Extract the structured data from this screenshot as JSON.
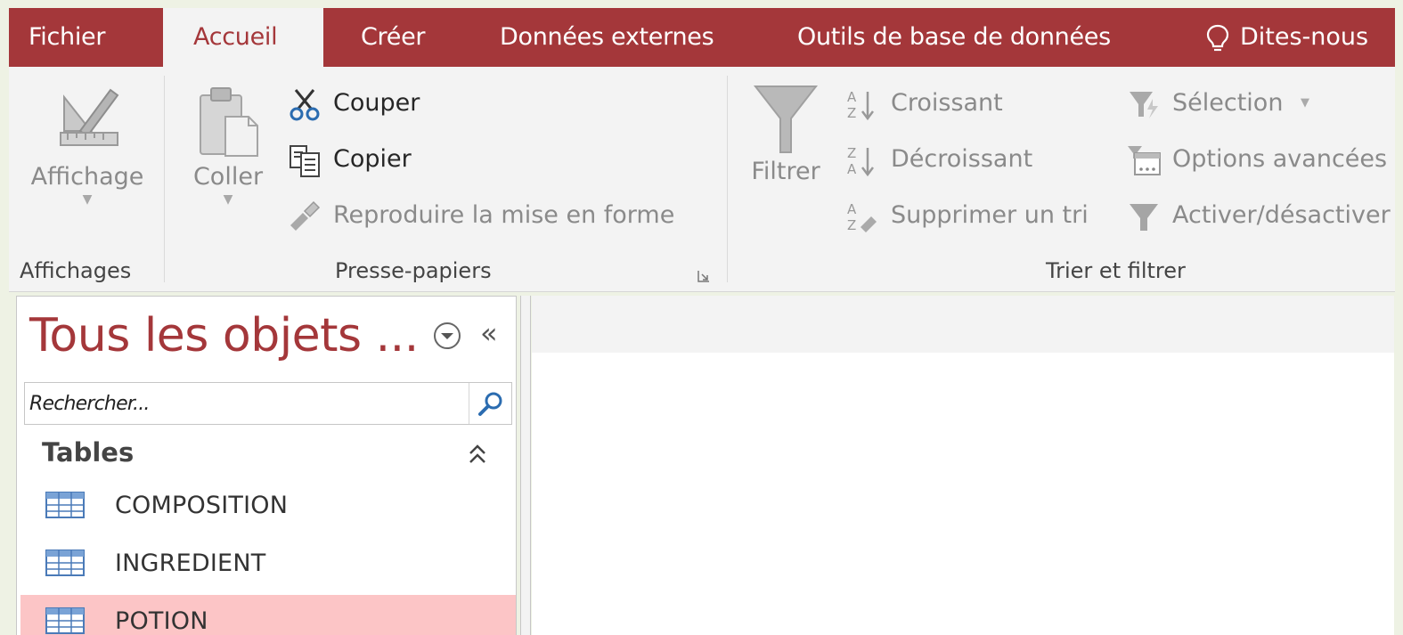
{
  "tabs": {
    "fichier": "Fichier",
    "accueil": "Accueil",
    "creer": "Créer",
    "donnees": "Données externes",
    "outils": "Outils de base de données",
    "tell_me": "Dites-nous"
  },
  "ribbon": {
    "affichage": "Affichage",
    "coller": "Coller",
    "couper": "Couper",
    "copier": "Copier",
    "reproduire": "Reproduire la mise en forme",
    "filtrer": "Filtrer",
    "croissant": "Croissant",
    "decroissant": "Décroissant",
    "supprimer_tri": "Supprimer un tri",
    "selection": "Sélection",
    "options": "Options avancées",
    "activer": "Activer/désactiver",
    "groups": {
      "affichages": "Affichages",
      "presse_papiers": "Presse-papiers",
      "trier_filtrer": "Trier et filtrer"
    }
  },
  "nav": {
    "title": "Tous les objets ...",
    "search_placeholder": "Rechercher...",
    "group": "Tables",
    "items": [
      "COMPOSITION",
      "INGREDIENT",
      "POTION"
    ],
    "selected_item": "POTION"
  },
  "colors": {
    "accent": "#a4373a",
    "selected_row": "#fcc5c6",
    "ribbon_bg": "#f3f3f3"
  }
}
